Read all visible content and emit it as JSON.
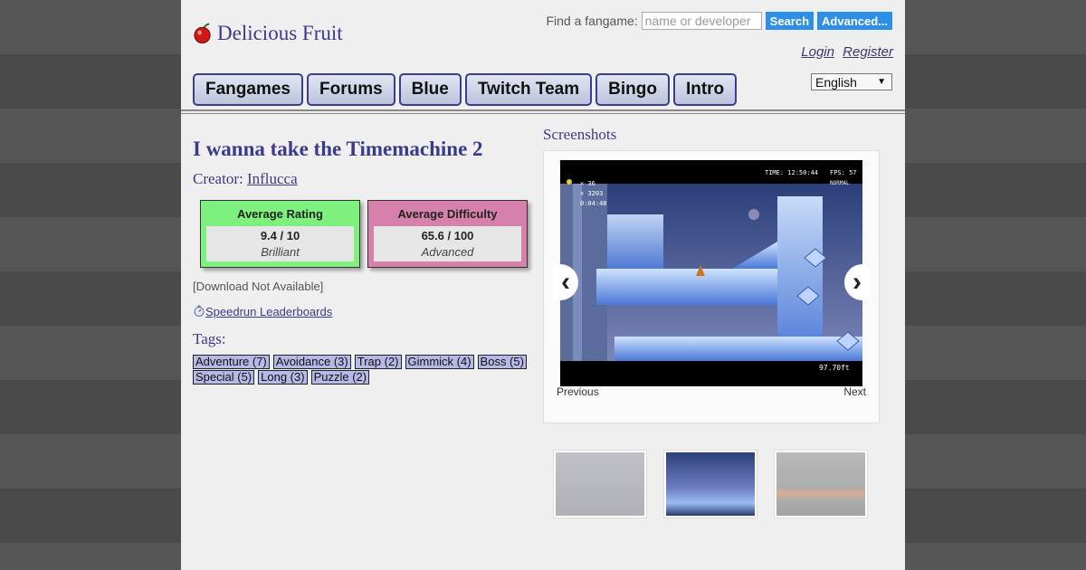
{
  "site": {
    "name": "Delicious Fruit"
  },
  "search": {
    "label": "Find a fangame:",
    "placeholder": "name or developer",
    "search_button": "Search",
    "advanced_button": "Advanced..."
  },
  "auth": {
    "login": "Login",
    "register": "Register"
  },
  "nav": {
    "items": [
      "Fangames",
      "Forums",
      "Blue",
      "Twitch Team",
      "Bingo",
      "Intro"
    ]
  },
  "language": {
    "selected": "English"
  },
  "game": {
    "title": "I wanna take the Timemachine 2",
    "creator_label": "Creator:",
    "creator": "Influcca",
    "rating": {
      "title": "Average Rating",
      "value": "9.4 / 10",
      "word": "Brilliant"
    },
    "difficulty": {
      "title": "Average Difficulty",
      "value": "65.6 / 100",
      "word": "Advanced"
    },
    "download": "[Download Not Available]",
    "speedrun": "Speedrun Leaderboards",
    "tags_title": "Tags:",
    "tags": [
      "Adventure (7)",
      "Avoidance (3)",
      "Trap (2)",
      "Gimmick (4)",
      "Boss (5)",
      "Special (5)",
      "Long (3)",
      "Puzzle (2)"
    ]
  },
  "screenshots": {
    "title": "Screenshots",
    "previous": "Previous",
    "next": "Next",
    "hud": {
      "line1": "× 36",
      "line2": "× 3203",
      "line3": "0:04:48",
      "time": "TIME: 12:50:44",
      "fps": "FPS: 57",
      "mode": "NORMAL",
      "bottom": "97.70ft"
    }
  },
  "colors": {
    "accent": "#3a3a8c",
    "rating_bg": "#7ef07e",
    "difficulty_bg": "#d581ab",
    "tag_bg": "#b8b8e8",
    "button_blue": "#2e8fe8"
  }
}
